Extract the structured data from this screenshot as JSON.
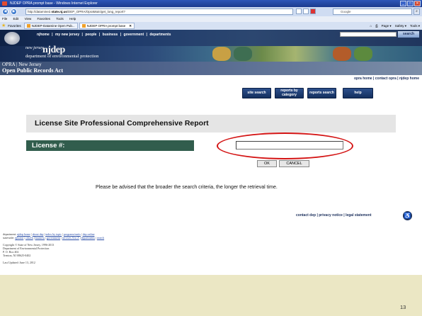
{
  "browser": {
    "title": "NJDEP OPRA prompt base - Windows Internet Explorer",
    "url_prefix": "http://datamine2.",
    "url_domain": "state.nj.us",
    "url_suffix": "/DEP_OPRA/OpraMain/get_long_report?",
    "search_placeholder": "Google",
    "menu": [
      "File",
      "Edit",
      "View",
      "Favorites",
      "Tools",
      "Help"
    ],
    "favorites_label": "Favorites",
    "tabs": [
      {
        "label": "NJDEP-Datamine Open Pub..."
      },
      {
        "label": "NJDEP OPRA prompt base"
      }
    ],
    "command_bar": [
      "Page ▾",
      "Safety ▾",
      "Tools ▾"
    ]
  },
  "site": {
    "nav_links": [
      "njhome",
      "my new jersey",
      "people",
      "business",
      "government",
      "departments"
    ],
    "search_button": "search",
    "banner_state": "new jersey",
    "banner_agency": "njdep",
    "banner_dept": "department of environmental protection",
    "opra_line1": "OPRA | New Jersey",
    "opra_line2": "Open Public Records Act",
    "opra_links": [
      "opra home",
      "contact opra",
      "njdep home"
    ]
  },
  "actions": {
    "site_search": "site search",
    "reports_by_category": "reports by category",
    "reports_search": "reports search",
    "help": "help"
  },
  "form": {
    "report_title": "License Site Professional Comprehensive Report",
    "license_label": "License #:",
    "license_value": "",
    "ok_label": "OK",
    "cancel_label": "CANCEL",
    "advisory": "Please be advised that the broader the search criteria, the longer the retrieval time."
  },
  "contact": {
    "links": [
      "contact dep",
      "privacy notice",
      "legal statement"
    ]
  },
  "footer": {
    "department_label": "department:",
    "department_links": [
      "njdep home",
      "about dep",
      "index by topic",
      "programs/units",
      "dep online"
    ],
    "statewide_label": "statewide:",
    "statewide_links": [
      "njhome",
      "citizen",
      "business",
      "government",
      "services A to Z",
      "departments",
      "search"
    ],
    "copyright": "Copyright © State of New Jersey, 1996-2013",
    "agency": "Department of Environmental Protection",
    "po_box": "P. O. Box 402",
    "address": "Trenton, NJ 08625-0402",
    "last_updated": "Last Updated: June 13, 2012"
  },
  "slide": {
    "number": "13"
  }
}
